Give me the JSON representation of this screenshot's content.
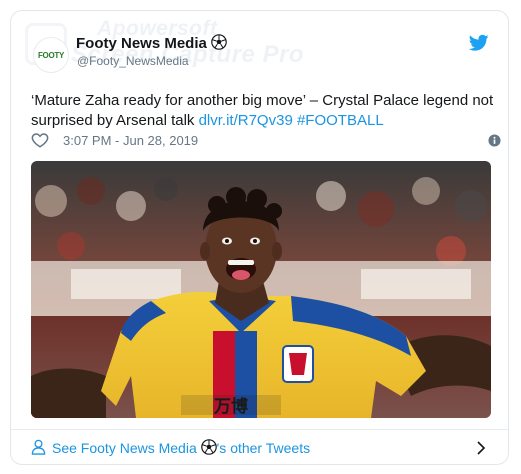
{
  "watermark": {
    "line1": "Apowersoft",
    "line2": "Screen Capture Pro"
  },
  "account": {
    "avatar_text": "FOOTY",
    "display_name": "Footy News Media",
    "handle": "@Footy_NewsMedia"
  },
  "tweet": {
    "text": "‘Mature Zaha ready for another big move’ – Crystal Palace legend not surprised by Arsenal talk ",
    "link": "dlvr.it/R7Qv39",
    "hashtag": "#FOOTBALL",
    "timestamp": "3:07 PM - Jun 28, 2019"
  },
  "media": {
    "shirt_sponsor": "万博"
  },
  "footer": {
    "text_before": "See Footy News Media ",
    "text_after": "'s other Tweets"
  },
  "colors": {
    "link": "#1b95e0",
    "muted": "#657786",
    "border": "#e1e8ed"
  },
  "icons": [
    "twitter-bird-icon",
    "football-icon",
    "heart-icon",
    "info-icon",
    "person-icon",
    "chevron-right-icon"
  ]
}
